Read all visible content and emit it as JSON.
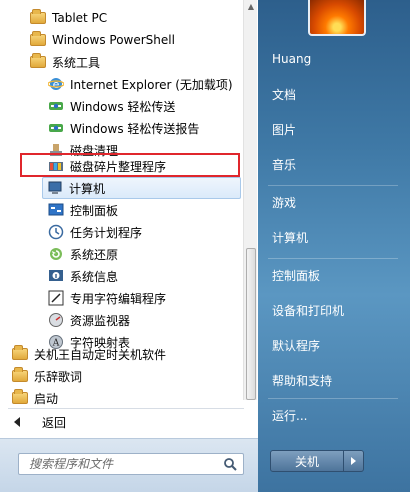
{
  "programs": {
    "items": [
      {
        "label": "Tablet PC",
        "icon": "folder-icon"
      },
      {
        "label": "Windows PowerShell",
        "icon": "folder-icon"
      },
      {
        "label": "系统工具",
        "icon": "folder-icon"
      },
      {
        "label": "Internet Explorer (无加载项)",
        "icon": "internet-explorer-icon"
      },
      {
        "label": "Windows 轻松传送",
        "icon": "easy-transfer-icon"
      },
      {
        "label": "Windows 轻松传送报告",
        "icon": "easy-transfer-report-icon"
      },
      {
        "label": "磁盘清理",
        "icon": "disk-cleanup-icon"
      },
      {
        "label": "磁盘碎片整理程序",
        "icon": "disk-defragmenter-icon"
      },
      {
        "label": "计算机",
        "icon": "computer-icon"
      },
      {
        "label": "控制面板",
        "icon": "control-panel-icon"
      },
      {
        "label": "任务计划程序",
        "icon": "task-scheduler-icon"
      },
      {
        "label": "系统还原",
        "icon": "system-restore-icon"
      },
      {
        "label": "系统信息",
        "icon": "system-information-icon"
      },
      {
        "label": "专用字符编辑程序",
        "icon": "private-character-editor-icon"
      },
      {
        "label": "资源监视器",
        "icon": "resource-monitor-icon"
      },
      {
        "label": "字符映射表",
        "icon": "character-map-icon"
      },
      {
        "label": "关机王自动定时关机软件",
        "icon": "folder-icon"
      },
      {
        "label": "乐辞歌词",
        "icon": "folder-icon"
      },
      {
        "label": "启动",
        "icon": "folder-icon"
      }
    ],
    "back_label": "返回"
  },
  "search": {
    "placeholder": "搜索程序和文件"
  },
  "right": {
    "items": [
      {
        "label": "Huang"
      },
      {
        "label": "文档"
      },
      {
        "label": "图片"
      },
      {
        "label": "音乐"
      },
      {
        "label": "游戏"
      },
      {
        "label": "计算机"
      },
      {
        "label": "控制面板"
      },
      {
        "label": "设备和打印机"
      },
      {
        "label": "默认程序"
      },
      {
        "label": "帮助和支持"
      },
      {
        "label": "运行..."
      }
    ],
    "shutdown_label": "关机"
  },
  "colors": {
    "highlight_border": "#e0262c",
    "right_pane": "#3f79a6"
  }
}
